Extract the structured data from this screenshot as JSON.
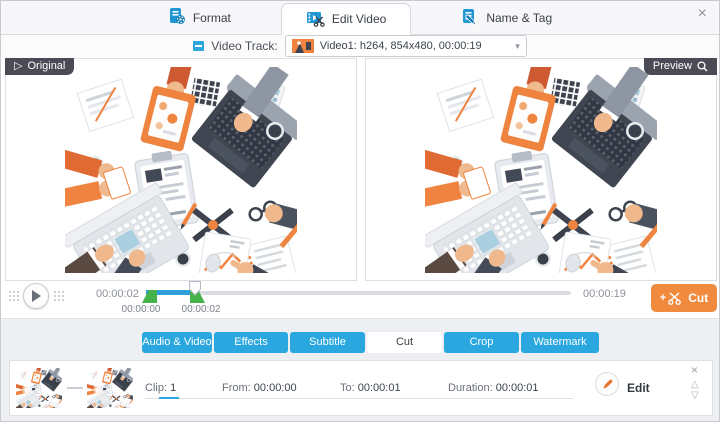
{
  "window": {
    "icons": {
      "close": "×",
      "caret_down": "▾",
      "original_play": "▷",
      "move_up": "△",
      "move_down": "▽",
      "clip_remove": "×",
      "plus": "+"
    }
  },
  "header": {
    "tabs": [
      {
        "label": "Format",
        "active": false
      },
      {
        "label": "Edit Video",
        "active": true
      },
      {
        "label": "Name & Tag",
        "active": false
      }
    ]
  },
  "track_bar": {
    "label": "Video Track:",
    "selected": "Video1: h264, 854x480, 00:00:19"
  },
  "preview": {
    "original_badge": "Original",
    "preview_badge": "Preview"
  },
  "transport": {
    "current_time": "00:00:02",
    "total_time": "00:00:19",
    "trim_start": "00:00:00",
    "trim_end": "00:00:02",
    "cut_button": "Cut"
  },
  "edit_tabs": [
    {
      "label": "Audio & Video",
      "active": false
    },
    {
      "label": "Effects",
      "active": false
    },
    {
      "label": "Subtitle",
      "active": false
    },
    {
      "label": "Cut",
      "active": true
    },
    {
      "label": "Crop",
      "active": false
    },
    {
      "label": "Watermark",
      "active": false
    }
  ],
  "clip_row": {
    "clip_label": "Clip:",
    "clip_value": "1",
    "from_label": "From:",
    "from_value": "00:00:00",
    "to_label": "To:",
    "to_value": "00:00:01",
    "duration_label": "Duration:",
    "duration_value": "00:00:01",
    "edit_button": "Edit"
  },
  "colors": {
    "accent_blue": "#2aa7df",
    "accent_orange": "#ef8a3f",
    "trim_green": "#45b24a",
    "badge_dark": "#4b4b55"
  }
}
